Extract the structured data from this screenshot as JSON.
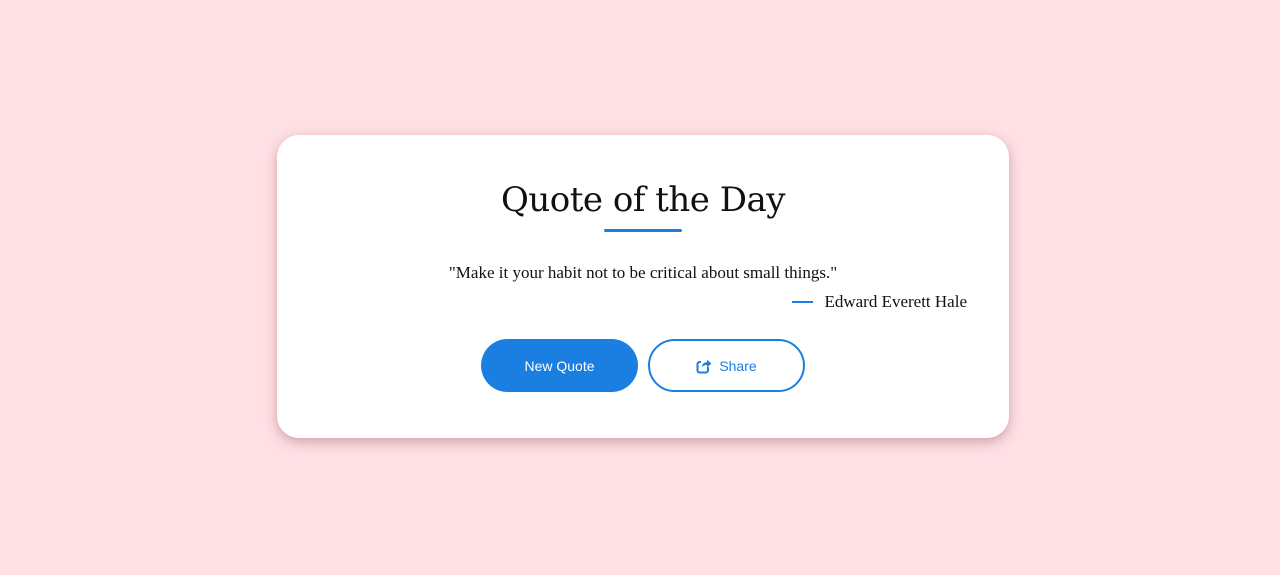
{
  "page": {
    "background_color": "#ffe0e5",
    "accent_color": "#1a7fe0"
  },
  "card": {
    "title": "Quote of the Day",
    "quote": "\"Make it your habit not to be critical about small things.\"",
    "author": "Edward Everett Hale"
  },
  "buttons": {
    "new_quote_label": "New Quote",
    "share_label": "Share",
    "share_icon": "share-square-icon"
  }
}
